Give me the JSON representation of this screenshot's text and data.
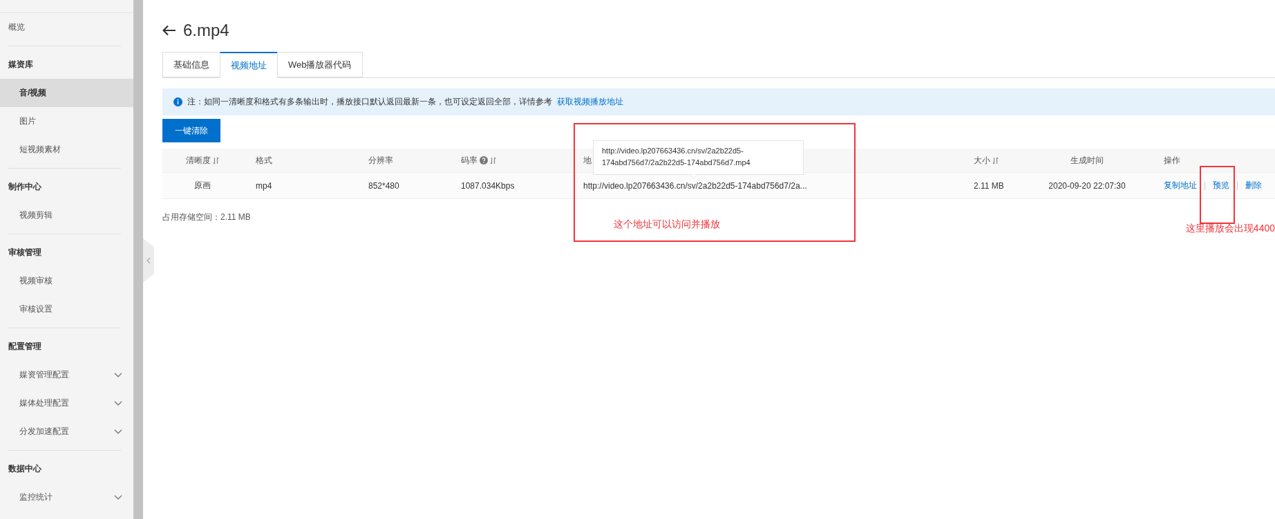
{
  "sidebar": {
    "items": [
      {
        "kind": "top",
        "label": "概览",
        "selected": false
      },
      {
        "kind": "heading",
        "label": "媒资库"
      },
      {
        "kind": "item",
        "label": "音/视频",
        "selected": true
      },
      {
        "kind": "item",
        "label": "图片",
        "selected": false
      },
      {
        "kind": "item",
        "label": "短视频素材",
        "selected": false
      },
      {
        "kind": "heading",
        "label": "制作中心"
      },
      {
        "kind": "item",
        "label": "视频剪辑",
        "selected": false
      },
      {
        "kind": "heading",
        "label": "审核管理"
      },
      {
        "kind": "item",
        "label": "视频审核",
        "selected": false
      },
      {
        "kind": "item",
        "label": "审核设置",
        "selected": false
      },
      {
        "kind": "heading",
        "label": "配置管理"
      },
      {
        "kind": "expandable",
        "label": "媒资管理配置",
        "selected": false
      },
      {
        "kind": "expandable",
        "label": "媒体处理配置",
        "selected": false
      },
      {
        "kind": "expandable",
        "label": "分发加速配置",
        "selected": false
      },
      {
        "kind": "heading",
        "label": "数据中心"
      },
      {
        "kind": "expandable",
        "label": "监控统计",
        "selected": false
      }
    ]
  },
  "title": "6.mp4",
  "tabs": [
    {
      "label": "基础信息",
      "selected": false
    },
    {
      "label": "视频地址",
      "selected": true
    },
    {
      "label": "Web播放器代码",
      "selected": false
    }
  ],
  "notice": {
    "text": "注：如同一清晰度和格式有多条输出时，播放接口默认返回最新一条，也可设定返回全部，详情参考",
    "link": "获取视频播放地址"
  },
  "clear_button": "一键清除",
  "table": {
    "columns": [
      {
        "label": "清晰度",
        "sortable": true,
        "help": false
      },
      {
        "label": "格式",
        "sortable": false,
        "help": false
      },
      {
        "label": "分辨率",
        "sortable": false,
        "help": false
      },
      {
        "label": "码率",
        "sortable": true,
        "help": true
      },
      {
        "label": "地"
      },
      {
        "label": "大小",
        "sortable": true,
        "help": false
      },
      {
        "label": "生成时间",
        "sortable": false,
        "help": false
      },
      {
        "label": "操作",
        "sortable": false,
        "help": false
      }
    ],
    "rows": [
      {
        "cells": [
          "原画",
          "mp4",
          "852*480",
          "1087.034Kbps",
          "http://video.lp207663436.cn/sv/2a2b22d5-174abd756d7/2a...",
          "2.11 MB",
          "2020-09-20 22:07:30"
        ],
        "actions": [
          "复制地址",
          "预览",
          "删除"
        ]
      }
    ]
  },
  "storage": "占用存储空间：2.11 MB",
  "tooltip": {
    "lines": [
      "http://video.lp207663436.cn/sv/2a2b22d5-",
      "174abd756d7/2a2b22d5-174abd756d7.mp4"
    ]
  },
  "annotations": [
    "这个地址可以访问并播放",
    "这里播放会出现4400"
  ]
}
